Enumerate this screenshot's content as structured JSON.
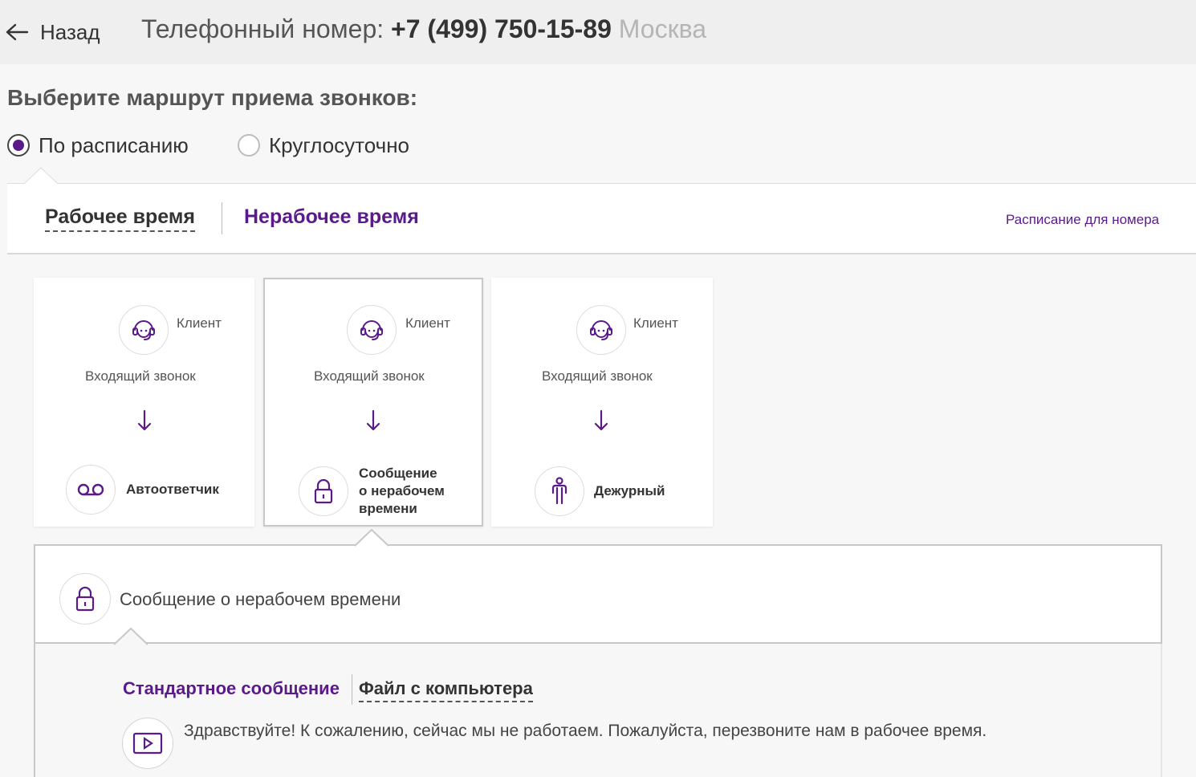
{
  "header": {
    "back_label": "Назад",
    "phone_prefix": "Телефонный номер:",
    "phone_number": "+7 (499) 750-15-89",
    "city": "Москва"
  },
  "route": {
    "title": "Выберите маршрут приема звонков:",
    "options": [
      {
        "label": "По расписанию",
        "selected": true
      },
      {
        "label": "Круглосуточно",
        "selected": false
      }
    ]
  },
  "schedule": {
    "tabs": [
      {
        "label": "Рабочее время",
        "active": true
      },
      {
        "label": "Нерабочее время",
        "active": false
      }
    ],
    "schedule_link": "Расписание для номера"
  },
  "cards": [
    {
      "client": "Клиент",
      "incoming": "Входящий звонок",
      "destination": "Автоответчик",
      "icon": "voicemail-icon",
      "selected": false
    },
    {
      "client": "Клиент",
      "incoming": "Входящий звонок",
      "destination_lines": [
        "Сообщение",
        "о нерабочем",
        "времени"
      ],
      "icon": "lock-icon",
      "selected": true
    },
    {
      "client": "Клиент",
      "incoming": "Входящий звонок",
      "destination": "Дежурный",
      "icon": "person-icon",
      "selected": false
    }
  ],
  "detail": {
    "title": "Сообщение о нерабочем времени",
    "message_tabs": [
      {
        "label": "Стандартное сообщение",
        "active": false
      },
      {
        "label": "Файл с компьютера",
        "active": true
      }
    ],
    "message_text": "Здравствуйте! К сожалению, сейчас мы не работаем. Пожалуйста, перезвоните нам в рабочее время."
  },
  "colors": {
    "accent": "#5a1a8a",
    "header_bg": "#efefef",
    "page_bg": "#f7f7f7",
    "border": "#c8c8c8"
  }
}
